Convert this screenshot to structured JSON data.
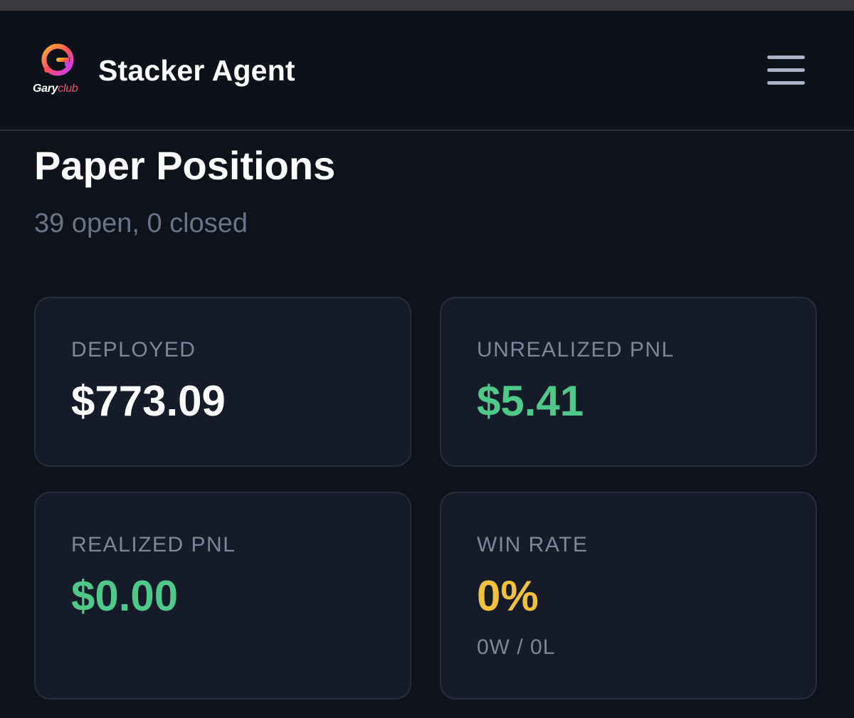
{
  "header": {
    "logo_text_primary": "Gary",
    "logo_text_secondary": "club",
    "app_title": "Stacker Agent",
    "menu_icon": "hamburger-menu-icon"
  },
  "page": {
    "title": "Paper Positions",
    "subtitle": "39 open, 0 closed"
  },
  "stats": {
    "deployed": {
      "label": "DEPLOYED",
      "value": "$773.09"
    },
    "unrealized_pnl": {
      "label": "UNREALIZED PNL",
      "value": "$5.41"
    },
    "realized_pnl": {
      "label": "REALIZED PNL",
      "value": "$0.00"
    },
    "win_rate": {
      "label": "WIN RATE",
      "value": "0%",
      "detail": "0W / 0L"
    }
  },
  "colors": {
    "background": "#0e121b",
    "card_background": "#151b28",
    "positive": "#4ec98a",
    "neutral_rate": "#f1c13d",
    "muted_text": "#7e879a",
    "logo_accent": "#f0506e"
  }
}
